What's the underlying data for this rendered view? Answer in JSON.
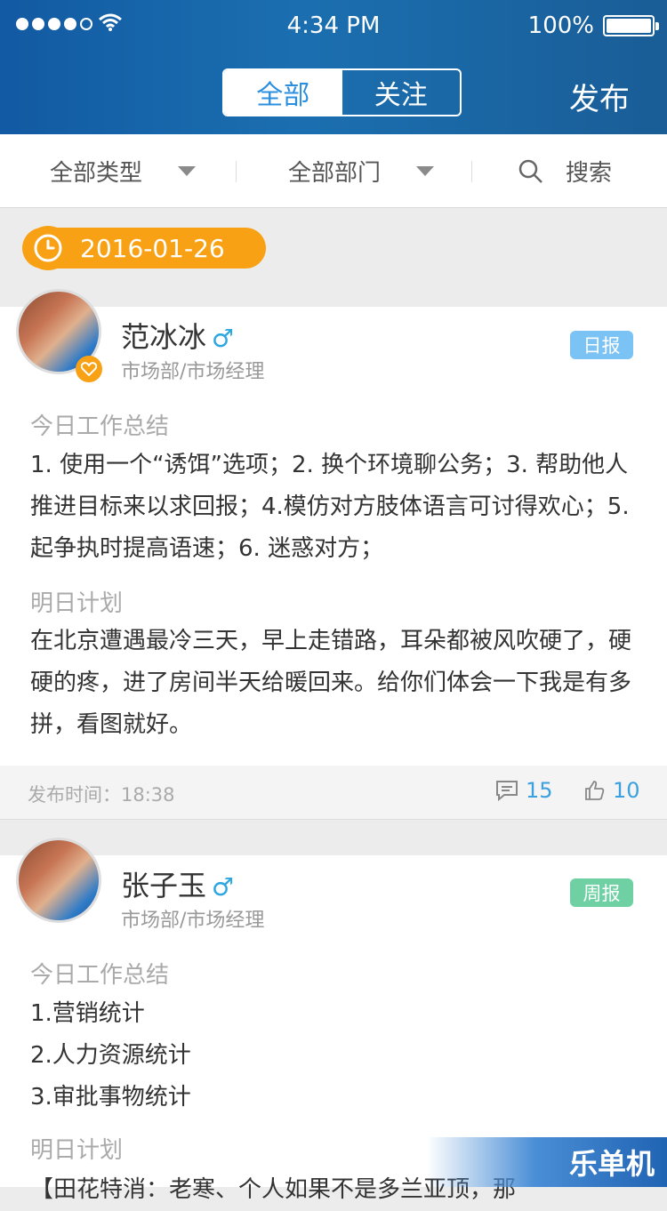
{
  "status_bar": {
    "time": "4:34 PM",
    "battery": "100%"
  },
  "header": {
    "tabs": [
      "全部",
      "关注"
    ],
    "active_tab": 0,
    "publish_label": "发布"
  },
  "filters": {
    "type_label": "全部类型",
    "dept_label": "全部部门",
    "search_label": "搜索"
  },
  "date": "2016-01-26",
  "posts": [
    {
      "name": "范冰冰",
      "gender_icon": "♂",
      "dept": "市场部/市场经理",
      "tag": "日报",
      "tag_color": "#7cc3f5",
      "summary_title": "今日工作总结",
      "summary": "1. 使用一个“诱饵”选项；2. 换个环境聊公务；3. 帮助他人推进目标来以求回报；4.模仿对方肢体语言可讨得欢心；5. 起争执时提高语速；6. 迷惑对方；",
      "plan_title": "明日计划",
      "plan": "在北京遭遇最冷三天，早上走错路，耳朵都被风吹硬了，硬硬的疼，进了房间半天给暖回来。给你们体会一下我是有多拼，看图就好。",
      "publish_time": "发布时间：18:38",
      "comments": "15",
      "likes": "10"
    },
    {
      "name": "张子玉",
      "gender_icon": "♂",
      "dept": "市场部/市场经理",
      "tag": "周报",
      "tag_color": "#6fd1a3",
      "summary_title": "今日工作总结",
      "summary_lines": [
        "1.营销统计",
        "2.人力资源统计",
        "3.审批事物统计"
      ],
      "plan_title": "明日计划",
      "plan_partial": "【田花特消：老寒、个人如果不是多兰亚顶，那"
    }
  ],
  "watermark": "乐单机"
}
